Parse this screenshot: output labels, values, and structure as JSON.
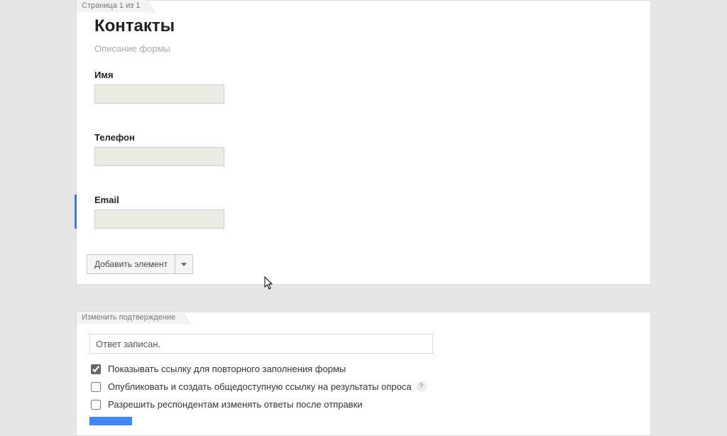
{
  "panel1": {
    "tab": "Страница 1 из 1",
    "title": "Контакты",
    "description": "Описание формы",
    "questions": [
      {
        "label": "Имя",
        "value": ""
      },
      {
        "label": "Телефон",
        "value": ""
      },
      {
        "label": "Email",
        "value": ""
      }
    ],
    "add_button": "Добавить элемент"
  },
  "panel2": {
    "tab": "Изменить подтверждение",
    "response_text": "Ответ записан.",
    "options": [
      {
        "label": "Показывать ссылку для повторного заполнения формы",
        "checked": true,
        "help": false
      },
      {
        "label": "Опубликовать и создать общедоступную ссылку на результаты опроса",
        "checked": false,
        "help": true
      },
      {
        "label": "Разрешить респондентам изменять ответы после отправки",
        "checked": false,
        "help": false
      }
    ]
  }
}
